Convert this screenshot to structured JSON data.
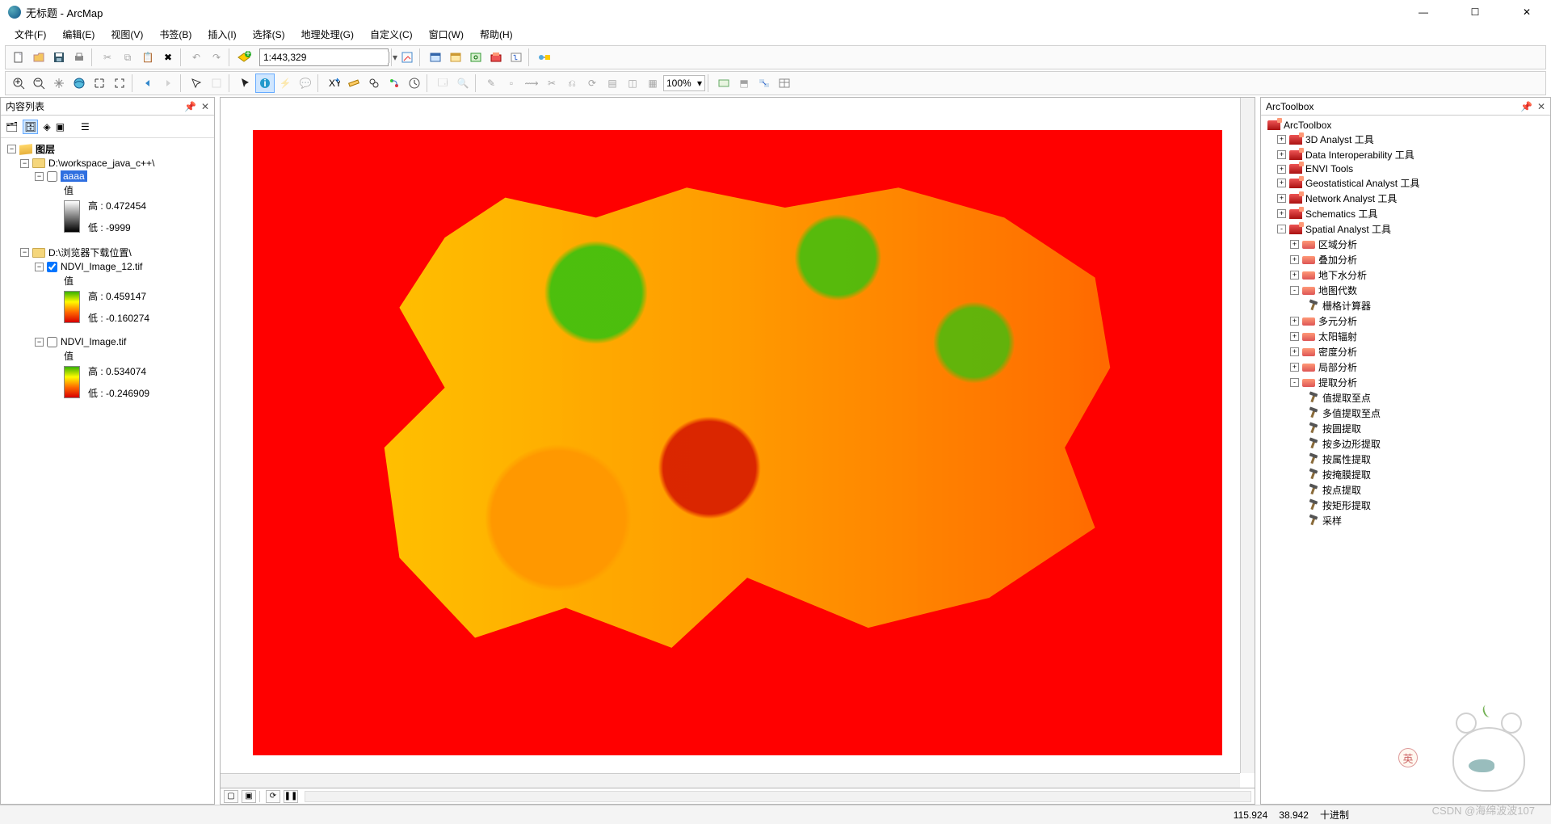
{
  "window": {
    "title": "无标题 - ArcMap"
  },
  "menu": [
    "文件(F)",
    "编辑(E)",
    "视图(V)",
    "书签(B)",
    "插入(I)",
    "选择(S)",
    "地理处理(G)",
    "自定义(C)",
    "窗口(W)",
    "帮助(H)"
  ],
  "toolbar": {
    "scale": "1:443,329",
    "zoom_pct": "100%"
  },
  "toc": {
    "title": "内容列表",
    "root": "图层",
    "groups": [
      {
        "path": "D:\\workspace_java_c++\\",
        "layers": [
          {
            "name": "aaaa",
            "checked": false,
            "selected": true,
            "ramp": "bw",
            "value_label": "值",
            "high_label": "高 :",
            "high": "0.472454",
            "low_label": "低 :",
            "low": "-9999"
          }
        ]
      },
      {
        "path": "D:\\浏览器下载位置\\",
        "layers": [
          {
            "name": "NDVI_Image_12.tif",
            "checked": true,
            "ramp": "gr",
            "value_label": "值",
            "high_label": "高 :",
            "high": "0.459147",
            "low_label": "低 :",
            "low": "-0.160274"
          },
          {
            "name": "NDVI_Image.tif",
            "checked": false,
            "ramp": "gr",
            "value_label": "值",
            "high_label": "高 :",
            "high": "0.534074",
            "low_label": "低 :",
            "low": "-0.246909"
          }
        ]
      }
    ]
  },
  "arctoolbox": {
    "title": "ArcToolbox",
    "root": "ArcToolbox",
    "toolboxes": [
      {
        "name": "3D Analyst 工具",
        "state": "+"
      },
      {
        "name": "Data Interoperability 工具",
        "state": "+"
      },
      {
        "name": "ENVI Tools",
        "state": "+"
      },
      {
        "name": "Geostatistical Analyst 工具",
        "state": "+"
      },
      {
        "name": "Network Analyst 工具",
        "state": "+"
      },
      {
        "name": "Schematics 工具",
        "state": "+"
      },
      {
        "name": "Spatial Analyst 工具",
        "state": "-",
        "toolsets": [
          {
            "name": "区域分析",
            "state": "+"
          },
          {
            "name": "叠加分析",
            "state": "+"
          },
          {
            "name": "地下水分析",
            "state": "+"
          },
          {
            "name": "地图代数",
            "state": "-",
            "tools": [
              "栅格计算器"
            ]
          },
          {
            "name": "多元分析",
            "state": "+"
          },
          {
            "name": "太阳辐射",
            "state": "+"
          },
          {
            "name": "密度分析",
            "state": "+"
          },
          {
            "name": "局部分析",
            "state": "+"
          },
          {
            "name": "提取分析",
            "state": "-",
            "tools": [
              "值提取至点",
              "多值提取至点",
              "按圆提取",
              "按多边形提取",
              "按属性提取",
              "按掩膜提取",
              "按点提取",
              "按矩形提取",
              "采样"
            ]
          }
        ]
      }
    ]
  },
  "status": {
    "x": "115.924",
    "y": "38.942",
    "units": "十进制"
  },
  "ime": "英",
  "watermark": "CSDN @海绵波波107"
}
